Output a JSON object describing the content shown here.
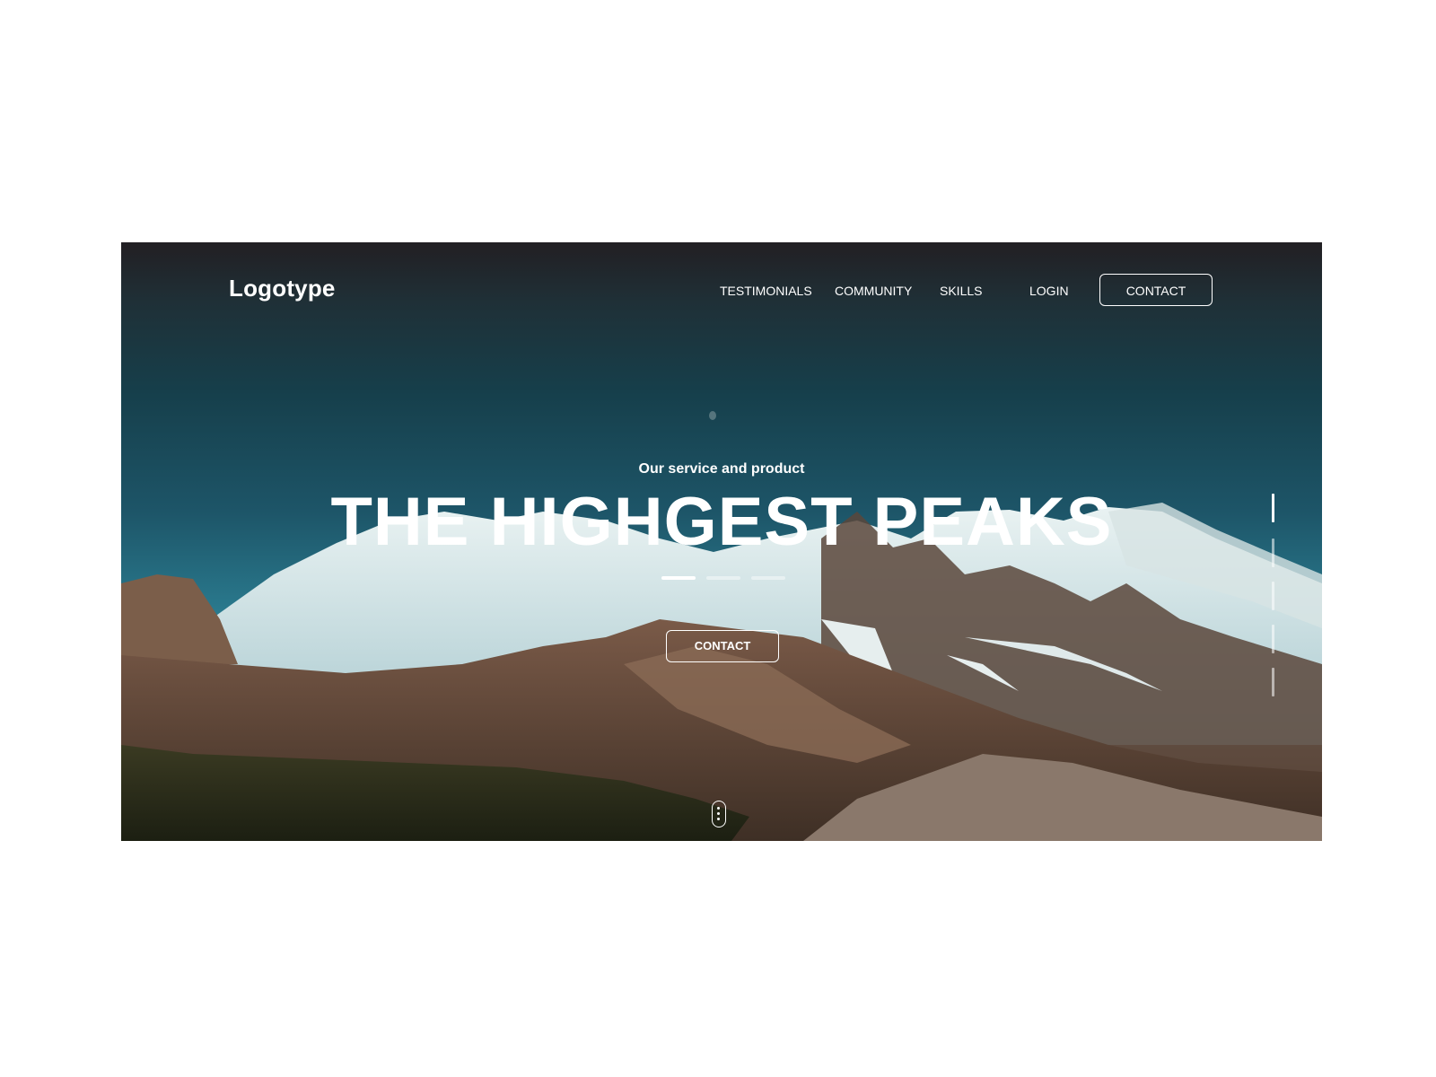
{
  "brand": {
    "logo_text": "Logotype"
  },
  "nav": {
    "items": [
      {
        "label": "TESTIMONIALS"
      },
      {
        "label": "COMMUNITY"
      },
      {
        "label": "SKILLS"
      },
      {
        "label": "LOGIN"
      }
    ],
    "contact_label": "CONTACT"
  },
  "hero": {
    "subtitle": "Our service and product",
    "title": "THE HIGHGEST PEAKS",
    "cta_label": "CONTACT",
    "slider": {
      "count": 3,
      "active_index": 0
    },
    "side_indicator": {
      "count": 5,
      "active_index": 0
    }
  },
  "colors": {
    "text": "#ffffff",
    "sky_top": "#221f23",
    "sky_mid": "#1d5568",
    "sky_bottom": "#3d8ea0",
    "page_background": "#ffffff"
  }
}
